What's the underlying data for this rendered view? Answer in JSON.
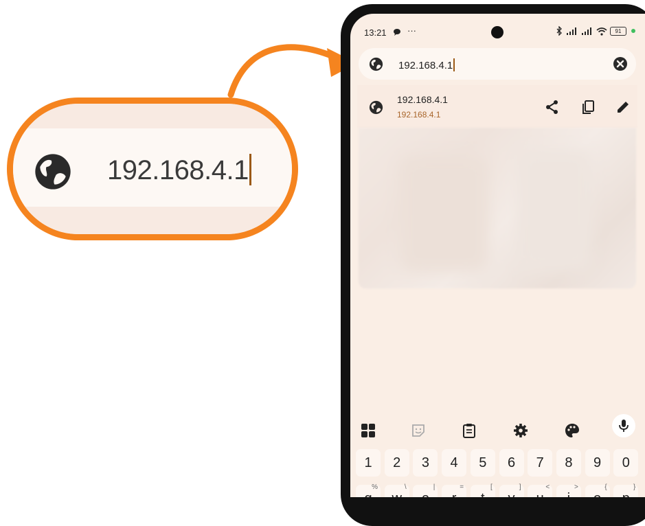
{
  "callout": {
    "url_text": "192.168.4.1",
    "globe_icon": "globe-icon"
  },
  "status_bar": {
    "time": "13:21",
    "dots": "···",
    "battery": "91"
  },
  "address_bar": {
    "value": "192.168.4.1"
  },
  "suggestion": {
    "title": "192.168.4.1",
    "subtitle": "192.168.4.1"
  },
  "keyboard": {
    "number_row": [
      "1",
      "2",
      "3",
      "4",
      "5",
      "6",
      "7",
      "8",
      "9",
      "0"
    ],
    "letter_row": [
      {
        "k": "q",
        "s": "%"
      },
      {
        "k": "w",
        "s": "\\"
      },
      {
        "k": "e",
        "s": "|"
      },
      {
        "k": "r",
        "s": "="
      },
      {
        "k": "t",
        "s": "["
      },
      {
        "k": "y",
        "s": "]"
      },
      {
        "k": "u",
        "s": "<"
      },
      {
        "k": "i",
        "s": ">"
      },
      {
        "k": "o",
        "s": "{"
      },
      {
        "k": "p",
        "s": "}"
      }
    ]
  },
  "colors": {
    "accent_orange": "#F5841F",
    "caret_brown": "#9b5a17",
    "screen_bg": "#faeee5"
  }
}
